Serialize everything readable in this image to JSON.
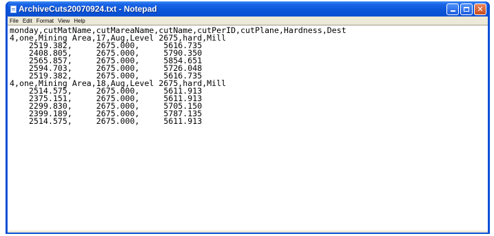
{
  "window": {
    "title": "ArchiveCuts20070924.txt - Notepad",
    "accent_color": "#0a4ed6",
    "controls": {
      "minimize_icon": "minimize-icon",
      "maximize_icon": "maximize-icon",
      "close_icon": "close-icon",
      "close_glyph": "✕"
    }
  },
  "menu": {
    "items": [
      "File",
      "Edit",
      "Format",
      "View",
      "Help"
    ]
  },
  "editor": {
    "lines": [
      "monday,cutMatName,cutMareaName,cutName,cutPerID,cutPlane,Hardness,Dest",
      "4,one,Mining Area,17,Aug,Level 2675,hard,Mill",
      "    2519.382,     2675.000,     5616.735",
      "    2408.805,     2675.000,     5790.350",
      "    2565.857,     2675.000,     5854.651",
      "    2594.703,     2675.000,     5726.048",
      "    2519.382,     2675.000,     5616.735",
      "4,one,Mining Area,18,Aug,Level 2675,hard,Mill",
      "    2514.575,     2675.000,     5611.913",
      "    2375.151,     2675.000,     5611.913",
      "    2299.830,     2675.000,     5705.150",
      "    2399.189,     2675.000,     5787.135",
      "    2514.575,     2675.000,     5611.913"
    ]
  }
}
